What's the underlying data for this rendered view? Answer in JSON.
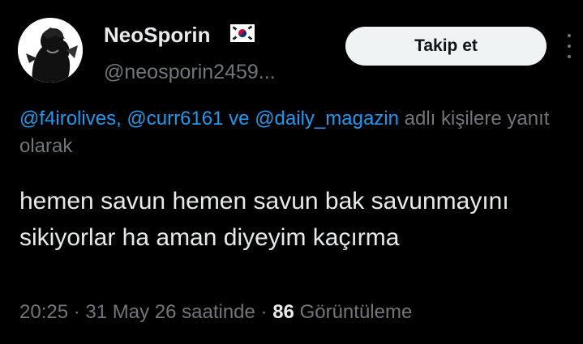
{
  "author": {
    "display_name": "NeoSporin",
    "flag_icon": "south-korea-flag-icon",
    "handle": "@neosporin2459..."
  },
  "follow_button_label": "Takip et",
  "more_icon": "more-horizontal-icon",
  "reply_context": {
    "mentions": [
      "@f4irolives",
      "@curr6161",
      "@daily_magazin"
    ],
    "separator_1": ", ",
    "separator_2": " ve ",
    "suffix": " adlı kişilere yanıt olarak"
  },
  "tweet_text": "hemen savun hemen savun bak savunmayını sikiyorlar ha aman diyeyim kaçırma",
  "meta": {
    "time": "20:25",
    "dot_1": " · ",
    "date": "31 May 26 saatinde",
    "dot_2": " · ",
    "views_count": "86",
    "views_label": " Görüntüleme"
  },
  "colors": {
    "background": "#000000",
    "text": "#e7e9ea",
    "secondary": "#71767b",
    "link": "#1d9bf0",
    "button_bg": "#eff3f4"
  }
}
